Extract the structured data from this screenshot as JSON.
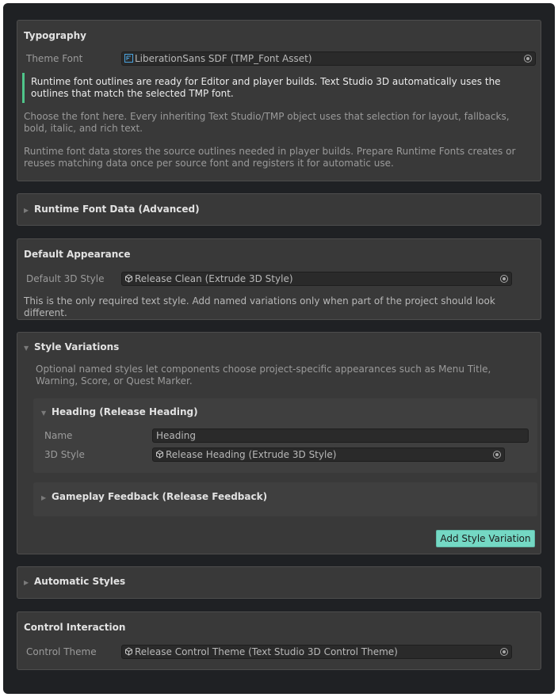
{
  "typography": {
    "title": "Typography",
    "theme_font_label": "Theme Font",
    "theme_font_value": "LiberationSans SDF (TMP_Font Asset)",
    "callout": "Runtime font outlines are ready for Editor and player builds. Text Studio 3D automatically uses the outlines that match the selected TMP font.",
    "help1": "Choose the font here. Every inheriting Text Studio/TMP object uses that selection for layout, fallbacks, bold, italic, and rich text.",
    "help2": "Runtime font data stores the source outlines needed in player builds. Prepare Runtime Fonts creates or reuses matching data once per source font and registers it for automatic use."
  },
  "runtime_font_data": {
    "title": "Runtime Font Data (Advanced)"
  },
  "default_appearance": {
    "title": "Default Appearance",
    "style_label": "Default 3D Style",
    "style_value": "Release Clean (Extrude 3D Style)",
    "help": "This is the only required text style. Add named variations only when part of the project should look different."
  },
  "style_variations": {
    "title": "Style Variations",
    "help": "Optional named styles let components choose project-specific appearances such as Menu Title, Warning, Score, or Quest Marker.",
    "items": [
      {
        "title": "Heading (Release Heading)",
        "name_label": "Name",
        "name_value": "Heading",
        "style_label": "3D Style",
        "style_value": "Release Heading (Extrude 3D Style)"
      },
      {
        "title": "Gameplay Feedback (Release Feedback)"
      }
    ],
    "add_button": "Add Style Variation"
  },
  "automatic_styles": {
    "title": "Automatic Styles"
  },
  "control_interaction": {
    "title": "Control Interaction",
    "theme_label": "Control Theme",
    "theme_value": "Release Control Theme (Text Studio 3D Control Theme)"
  },
  "colors": {
    "panel_bg": "#393939",
    "window_bg": "#1f2124",
    "accent_button": "#74d8c4",
    "callout_bar": "#4fc58a"
  }
}
